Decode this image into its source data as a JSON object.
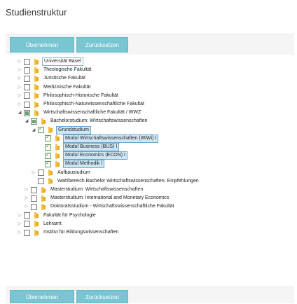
{
  "page": {
    "title": "Studienstruktur"
  },
  "toolbar": {
    "apply_label": "Übernehmen",
    "reset_label": "Zurücksetzen"
  },
  "tree": [
    {
      "label": "Universität Basel",
      "level": 0,
      "arrow": "collapsed",
      "check": "none",
      "style": "boxed"
    },
    {
      "label": "Theologische Fakultät",
      "level": 0,
      "arrow": "collapsed",
      "check": "none"
    },
    {
      "label": "Juristische Fakultät",
      "level": 0,
      "arrow": "collapsed",
      "check": "none"
    },
    {
      "label": "Medizinische Fakultät",
      "level": 0,
      "arrow": "collapsed",
      "check": "none"
    },
    {
      "label": "Philosophisch-Historische Fakultät",
      "level": 0,
      "arrow": "collapsed",
      "check": "none"
    },
    {
      "label": "Philosophisch-Naturwissenschaftliche Fakultät",
      "level": 0,
      "arrow": "collapsed",
      "check": "none"
    },
    {
      "label": "Wirtschaftswissenschaftliche Fakultät / WWZ",
      "level": 0,
      "arrow": "expanded",
      "check": "partial"
    },
    {
      "label": "Bachelorstudium: Wirtschaftswissenschaften",
      "level": 1,
      "arrow": "expanded",
      "check": "partial"
    },
    {
      "label": "Grundstudium",
      "level": 2,
      "arrow": "expanded",
      "check": "checked",
      "style": "sel"
    },
    {
      "label": "Modul Wirtschaftswissenschaften (WiWi) I",
      "level": 3,
      "arrow": "none",
      "check": "checked",
      "style": "sel"
    },
    {
      "label": "Modul Business (BUS) I",
      "level": 3,
      "arrow": "none",
      "check": "checked",
      "style": "sel"
    },
    {
      "label": "Modul Economics (ECON) I",
      "level": 3,
      "arrow": "none",
      "check": "checked",
      "style": "sel"
    },
    {
      "label": "Modul Methodik I",
      "level": 3,
      "arrow": "none",
      "check": "checked",
      "style": "sel"
    },
    {
      "label": "Aufbaustudium",
      "level": 2,
      "arrow": "collapsed",
      "check": "none"
    },
    {
      "label": "Wahlbereich Bachelor Wirtschaftswissenschaften: Empfehlungen",
      "level": 2,
      "arrow": "none",
      "check": "none"
    },
    {
      "label": "Masterstudium: Wirtschaftswissenschaften",
      "level": 1,
      "arrow": "collapsed",
      "check": "none"
    },
    {
      "label": "Masterstudium: International and Monetary Economics",
      "level": 1,
      "arrow": "collapsed",
      "check": "none"
    },
    {
      "label": "Doktoratsstudium - Wirtschaftswissenschaftliche Fakultät",
      "level": 1,
      "arrow": "collapsed",
      "check": "none"
    },
    {
      "label": "Fakultät für Psychologie",
      "level": 0,
      "arrow": "collapsed",
      "check": "none"
    },
    {
      "label": "Lehramt",
      "level": 0,
      "arrow": "collapsed",
      "check": "none"
    },
    {
      "label": "Institut für Bildungswissenschaften",
      "level": 0,
      "arrow": "collapsed",
      "check": "none"
    }
  ]
}
